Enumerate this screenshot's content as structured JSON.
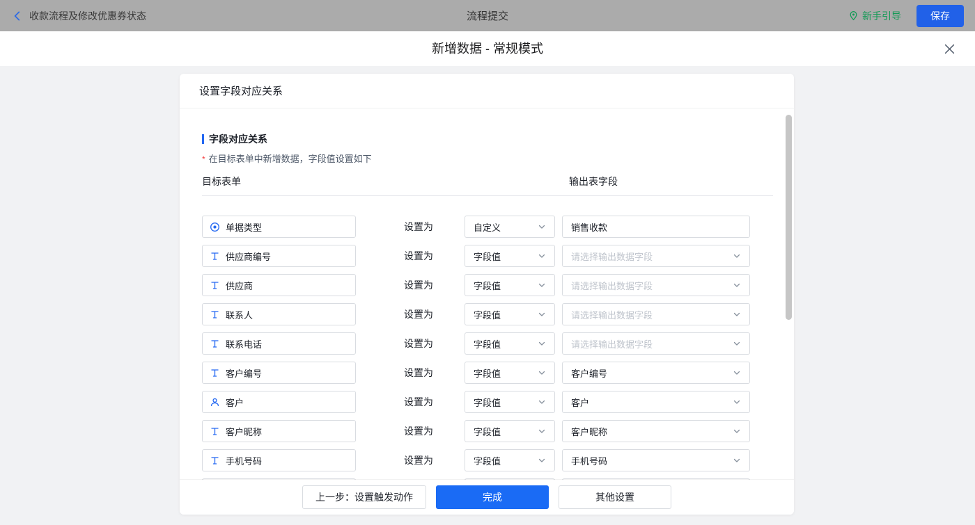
{
  "topbar": {
    "back_label": "收款流程及修改优惠券状态",
    "title": "流程提交",
    "guide_label": "新手引导",
    "save_label": "保存"
  },
  "modal": {
    "title": "新增数据 - 常规模式",
    "panel_title": "设置字段对应关系",
    "section_title": "字段对应关系",
    "required_mark": "*",
    "note": "在目标表单中新增数据，字段值设置如下",
    "columns": {
      "target": "目标表单",
      "output": "输出表字段"
    },
    "set_as_label": "设置为",
    "rows": [
      {
        "field": "单据类型",
        "icon": "radio-icon",
        "mode": "自定义",
        "output": "销售收款",
        "output_type": "input",
        "output_placeholder": false
      },
      {
        "field": "供应商编号",
        "icon": "text-icon",
        "mode": "字段值",
        "output": "请选择输出数据字段",
        "output_type": "select",
        "output_placeholder": true
      },
      {
        "field": "供应商",
        "icon": "text-icon",
        "mode": "字段值",
        "output": "请选择输出数据字段",
        "output_type": "select",
        "output_placeholder": true
      },
      {
        "field": "联系人",
        "icon": "text-icon",
        "mode": "字段值",
        "output": "请选择输出数据字段",
        "output_type": "select",
        "output_placeholder": true
      },
      {
        "field": "联系电话",
        "icon": "text-icon",
        "mode": "字段值",
        "output": "请选择输出数据字段",
        "output_type": "select",
        "output_placeholder": true
      },
      {
        "field": "客户编号",
        "icon": "text-icon",
        "mode": "字段值",
        "output": "客户编号",
        "output_type": "select",
        "output_placeholder": false
      },
      {
        "field": "客户",
        "icon": "user-icon",
        "mode": "字段值",
        "output": "客户",
        "output_type": "select",
        "output_placeholder": false
      },
      {
        "field": "客户昵称",
        "icon": "text-icon",
        "mode": "字段值",
        "output": "客户昵称",
        "output_type": "select",
        "output_placeholder": false
      },
      {
        "field": "手机号码",
        "icon": "text-icon",
        "mode": "字段值",
        "output": "手机号码",
        "output_type": "select",
        "output_placeholder": false
      },
      {
        "field": "",
        "icon": "",
        "mode": "",
        "output": "",
        "output_type": "select",
        "output_placeholder": false
      }
    ],
    "footer": {
      "prev_label": "上一步：设置触发动作",
      "done_label": "完成",
      "other_label": "其他设置"
    }
  },
  "colors": {
    "accent_blue": "#2468f2",
    "guide_green": "#149a56",
    "danger_red": "#f53f3f"
  }
}
